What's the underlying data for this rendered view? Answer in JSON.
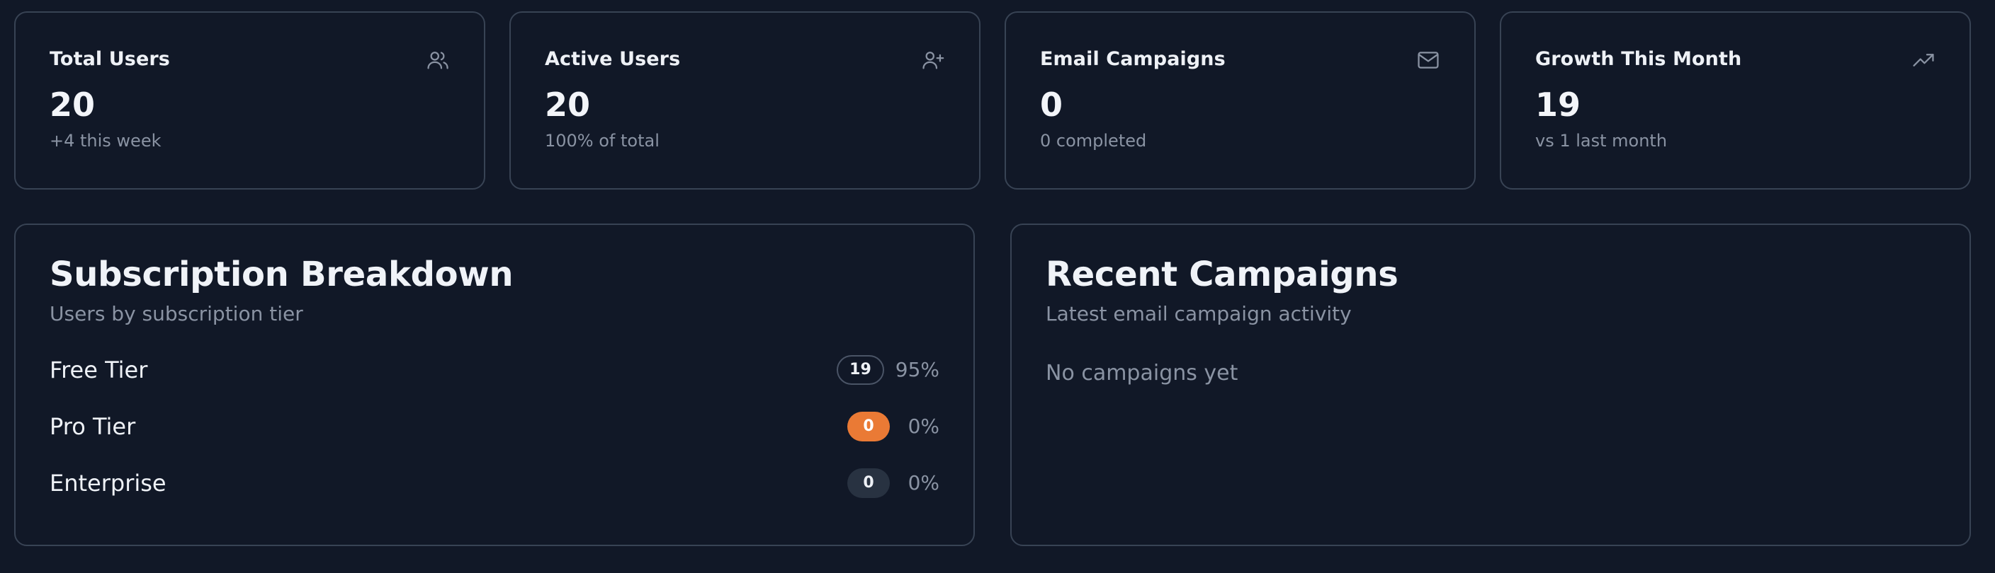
{
  "stats": [
    {
      "title": "Total Users",
      "value": "20",
      "sub": "+4 this week",
      "icon": "users-icon"
    },
    {
      "title": "Active Users",
      "value": "20",
      "sub": "100% of total",
      "icon": "user-plus-icon"
    },
    {
      "title": "Email Campaigns",
      "value": "0",
      "sub": "0 completed",
      "icon": "mail-icon"
    },
    {
      "title": "Growth This Month",
      "value": "19",
      "sub": "vs 1 last month",
      "icon": "trending-up-icon"
    }
  ],
  "subscription": {
    "title": "Subscription Breakdown",
    "subtitle": "Users by subscription tier",
    "tiers": [
      {
        "name": "Free Tier",
        "count": "19",
        "percent": "95%",
        "badge_color": "#111827"
      },
      {
        "name": "Pro Tier",
        "count": "0",
        "percent": "0%",
        "badge_color": "#ea7a35"
      },
      {
        "name": "Enterprise",
        "count": "0",
        "percent": "0%",
        "badge_color": "#283241"
      }
    ]
  },
  "campaigns": {
    "title": "Recent Campaigns",
    "subtitle": "Latest email campaign activity",
    "empty_text": "No campaigns yet"
  },
  "colors": {
    "background": "#111827",
    "border": "#384354",
    "muted_text": "#8a93a3",
    "accent_orange": "#ea7a35"
  }
}
